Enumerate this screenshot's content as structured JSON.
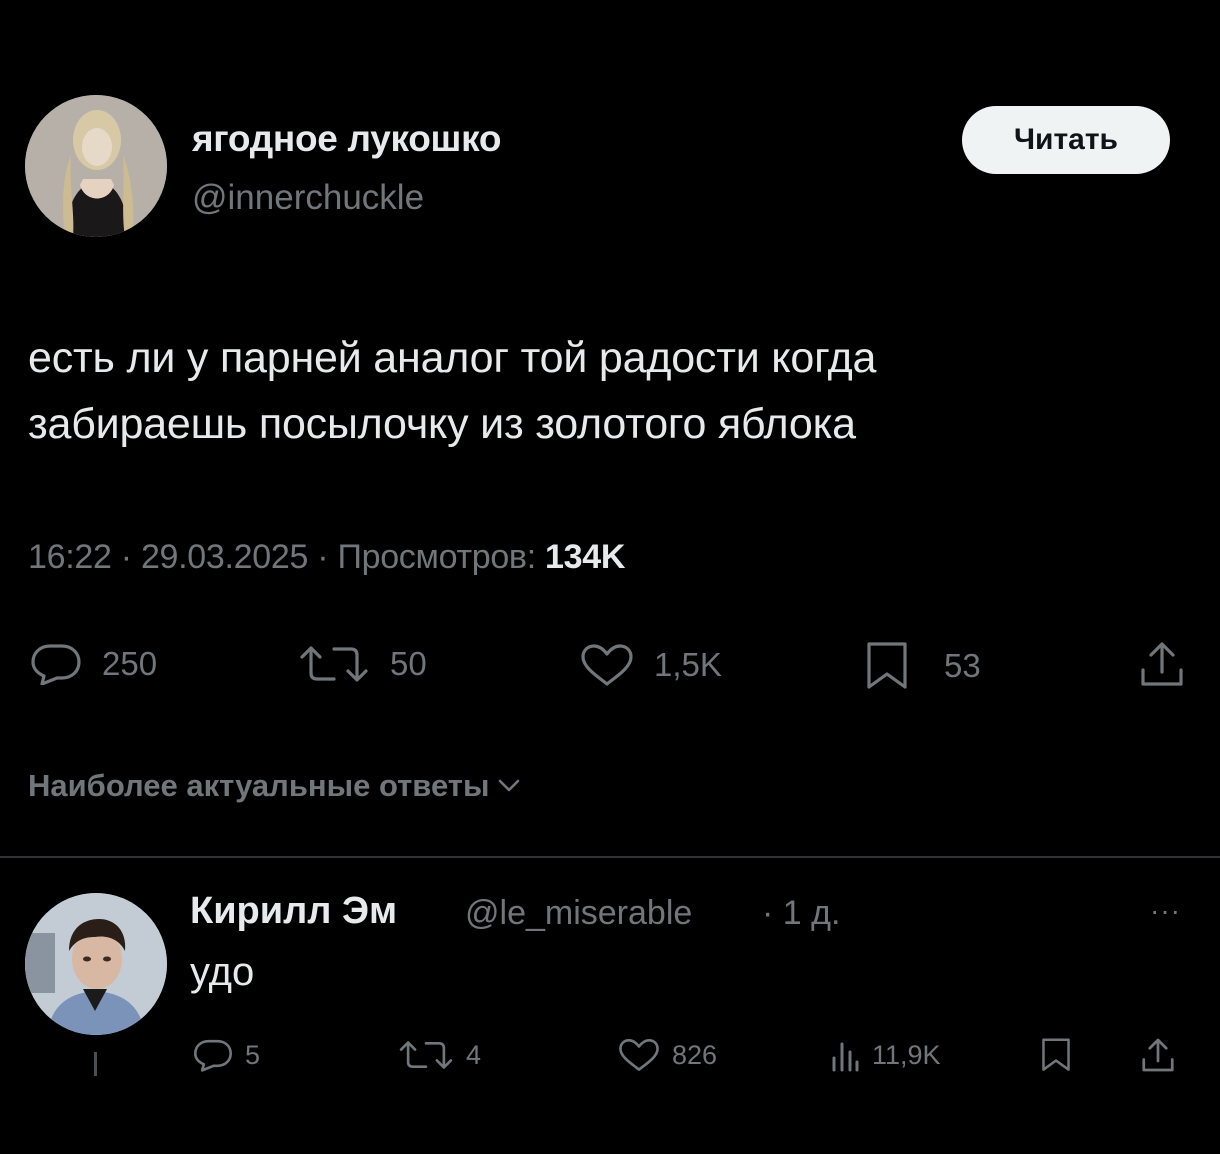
{
  "tweet": {
    "author": {
      "display_name": "ягодное лукошко",
      "handle": "@innerchuckle"
    },
    "follow_label": "Читать",
    "text_lines": [
      "есть ли у парней аналог той радости когда",
      "забираешь посылочку из золотого яблока"
    ],
    "time": "16:22",
    "date": "29.03.2025",
    "separator": "·",
    "views_label": "Просмотров:",
    "views_count": "134K",
    "stats": {
      "replies": "250",
      "reposts": "50",
      "likes": "1,5K",
      "bookmarks": "53"
    }
  },
  "replies_sort": {
    "label": "Наиболее актуальные ответы",
    "icon": "chevron-down-icon"
  },
  "reply": {
    "display_name": "Кирилл Эм",
    "handle": "@le_miserable",
    "separator": "·",
    "time": "1 д.",
    "more_label": "···",
    "text": "удо",
    "stats": {
      "replies": "5",
      "reposts": "4",
      "likes": "826",
      "views": "11,9K"
    }
  },
  "icons": {
    "reply": "reply-icon",
    "repost": "repost-icon",
    "like": "heart-icon",
    "bookmark": "bookmark-icon",
    "share": "share-icon",
    "views": "views-icon"
  },
  "colors": {
    "background": "#000000",
    "primary_text": "#e7e9ea",
    "secondary_text": "#71767b",
    "divider": "#2f3336",
    "follow_button_bg": "#eff3f4",
    "follow_button_text": "#0f1419"
  }
}
